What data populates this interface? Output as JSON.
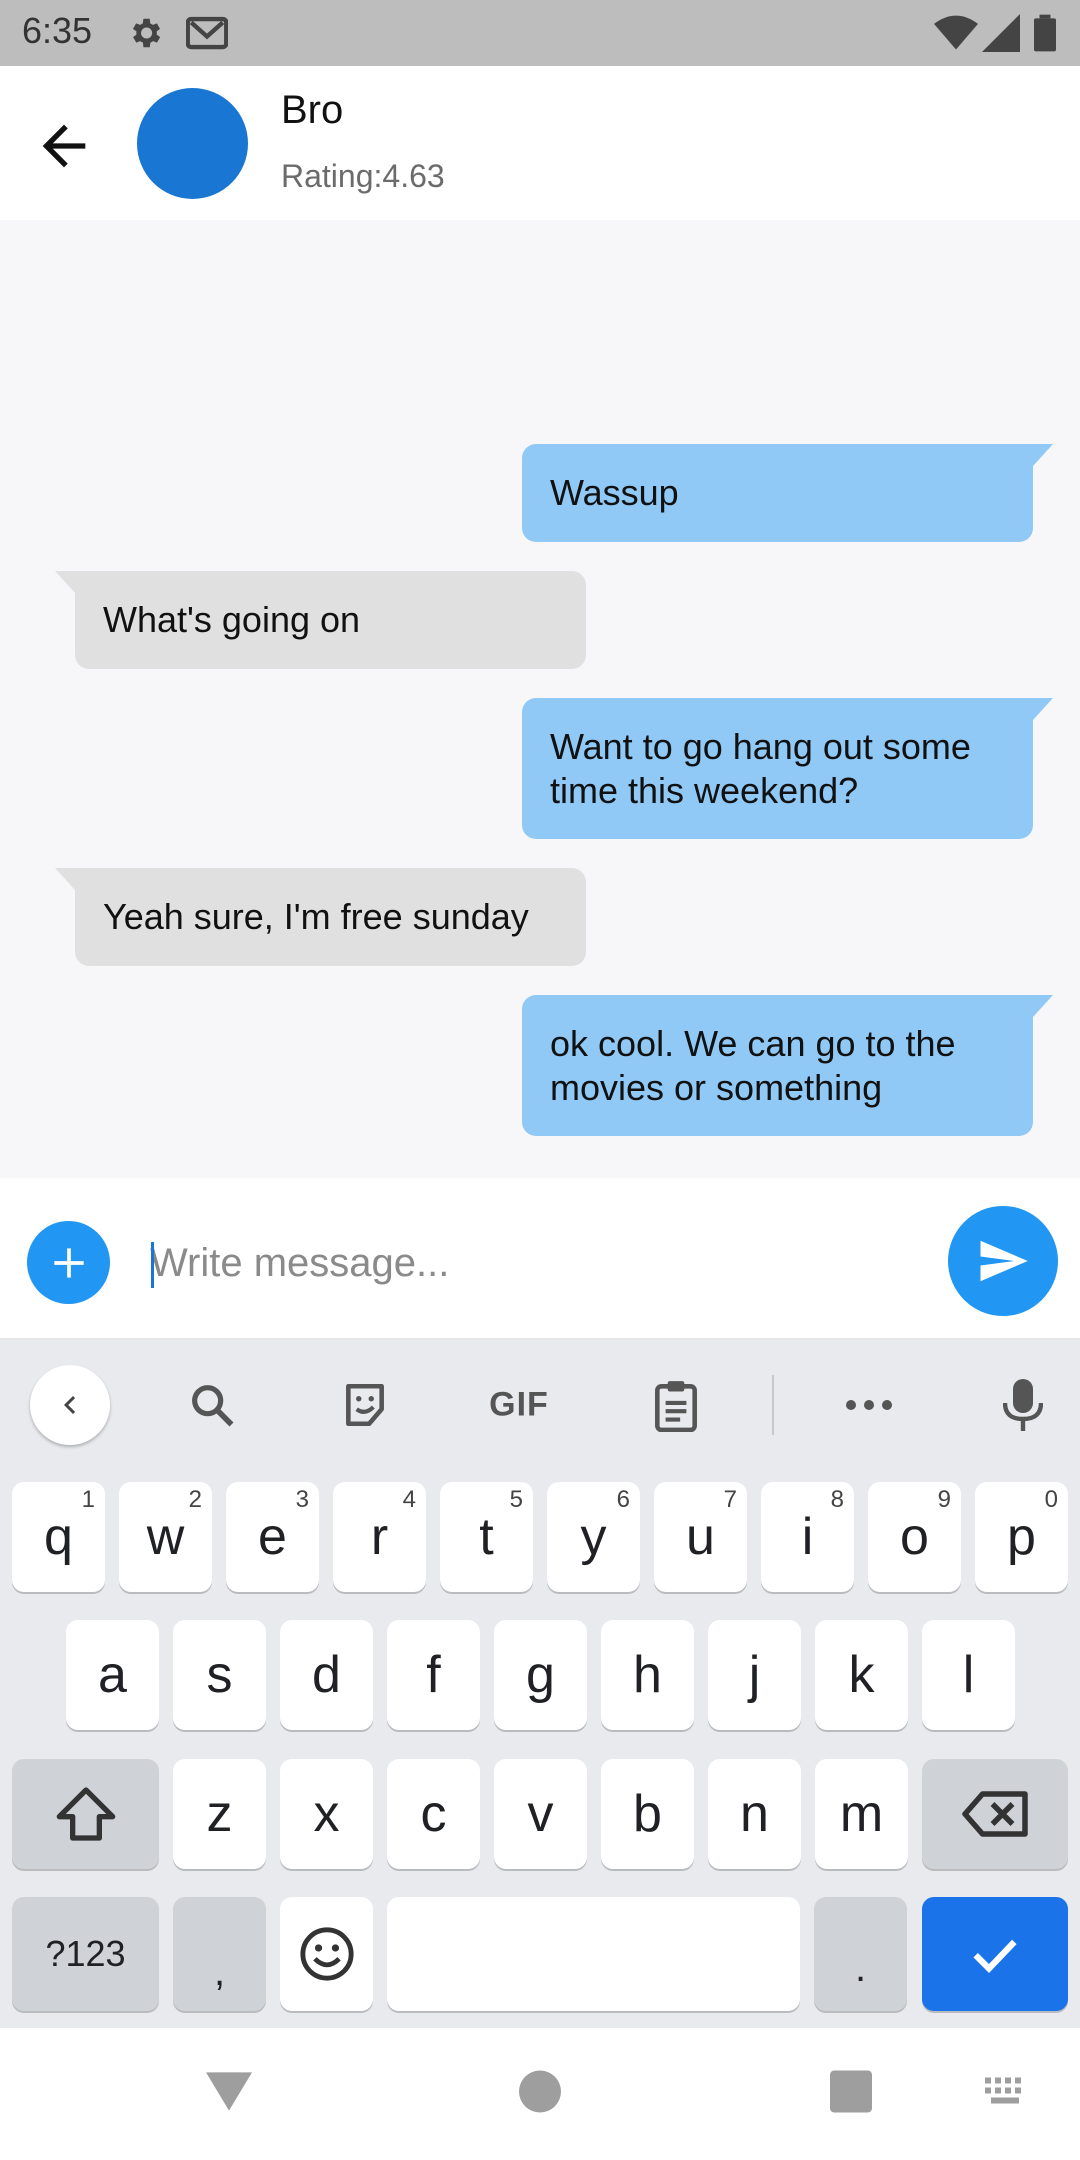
{
  "status_bar": {
    "time": "6:35",
    "icons": [
      "settings-icon",
      "gmail-icon",
      "wifi-icon",
      "signal-icon",
      "battery-icon"
    ]
  },
  "header": {
    "contact_name": "Bro",
    "rating": "Rating:4.63",
    "avatar_color": "#1976d2"
  },
  "messages": [
    {
      "direction": "sent",
      "text": "Wassup"
    },
    {
      "direction": "received",
      "text": "What's going on"
    },
    {
      "direction": "sent",
      "text": "Want to go hang out some time this weekend?"
    },
    {
      "direction": "received",
      "text": "Yeah sure, I'm free sunday"
    },
    {
      "direction": "sent",
      "text": "ok cool. We can go to the movies or something"
    }
  ],
  "composer": {
    "placeholder": "Write message...",
    "value": ""
  },
  "keyboard": {
    "toolbar": [
      "back-icon",
      "search-icon",
      "sticker-icon",
      "GIF",
      "clipboard-icon",
      "more-icon",
      "mic-icon"
    ],
    "row1": [
      {
        "key": "q",
        "hint": "1"
      },
      {
        "key": "w",
        "hint": "2"
      },
      {
        "key": "e",
        "hint": "3"
      },
      {
        "key": "r",
        "hint": "4"
      },
      {
        "key": "t",
        "hint": "5"
      },
      {
        "key": "y",
        "hint": "6"
      },
      {
        "key": "u",
        "hint": "7"
      },
      {
        "key": "i",
        "hint": "8"
      },
      {
        "key": "o",
        "hint": "9"
      },
      {
        "key": "p",
        "hint": "0"
      }
    ],
    "row2": [
      "a",
      "s",
      "d",
      "f",
      "g",
      "h",
      "j",
      "k",
      "l"
    ],
    "row3": [
      "z",
      "x",
      "c",
      "v",
      "b",
      "n",
      "m"
    ],
    "symbols_label": "?123",
    "comma": ",",
    "period": "."
  },
  "colors": {
    "sent_bubble": "#90c8f6",
    "received_bubble": "#e0e0e0",
    "accent": "#2196f3",
    "enter_key": "#1a73e8"
  }
}
